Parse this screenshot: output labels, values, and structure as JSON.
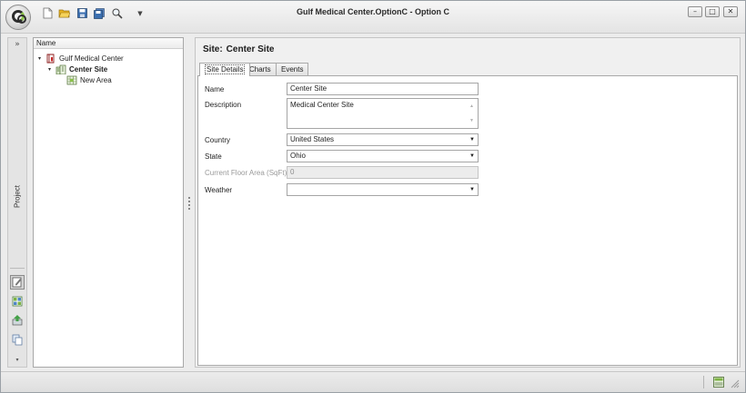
{
  "window": {
    "title": "Gulf Medical Center.OptionC - Option C",
    "controls": {
      "minimize": "–",
      "maximize": "□",
      "close": "✕"
    }
  },
  "quick_access": {
    "items": [
      "new-document-icon",
      "open-folder-icon",
      "save-icon",
      "save-all-icon",
      "zoom-icon",
      "customize-dropdown-icon"
    ]
  },
  "left_strip": {
    "expand": "»",
    "panel_label": "Project",
    "buttons": [
      "edit-icon",
      "grid-icon",
      "export-icon",
      "copy-icon"
    ],
    "more": "▾"
  },
  "tree": {
    "header": "Name",
    "nodes": [
      {
        "label": "Gulf Medical Center",
        "icon": "book-icon",
        "toggle": "▾",
        "bold": false
      },
      {
        "label": "Center Site",
        "icon": "building-icon",
        "toggle": "▾",
        "bold": true
      },
      {
        "label": "New Area",
        "icon": "area-icon",
        "toggle": "",
        "bold": false
      }
    ]
  },
  "main": {
    "heading_prefix": "Site:",
    "heading_value": "Center Site",
    "tabs": [
      "Site Details",
      "Charts",
      "Events"
    ],
    "active_tab": "Site Details",
    "fields": {
      "name": {
        "label": "Name",
        "value": "Center Site"
      },
      "description": {
        "label": "Description",
        "value": "Medical Center Site"
      },
      "country": {
        "label": "Country",
        "value": "United States"
      },
      "state": {
        "label": "State",
        "value": "Ohio"
      },
      "floor_area": {
        "label": "Current Floor Area (SqFt)",
        "value": "0"
      },
      "weather": {
        "label": "Weather",
        "value": ""
      }
    },
    "dropdown_arrow": "▼"
  },
  "colors": {
    "accent_green": "#8bc34a",
    "folder_yellow": "#e8b321",
    "disk_blue": "#3b6fb0"
  }
}
